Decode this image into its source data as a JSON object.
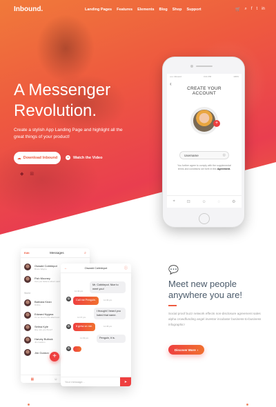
{
  "nav": {
    "logo": "Inbound.",
    "menu": [
      "Landing Pages",
      "Features",
      "Elements",
      "Blog",
      "Shop",
      "Support"
    ],
    "icons": [
      "cart-icon",
      "search-icon",
      "facebook-icon",
      "twitter-icon",
      "linkedin-icon"
    ]
  },
  "hero": {
    "title_line1": "A Messenger",
    "title_line2": "Revolution.",
    "subtitle": "Create a stylish App Landing Page and highlight all the great things of your product!",
    "download_label": "Download Inbound",
    "video_label": "Watch the Video",
    "platforms": [
      "apple-icon",
      "android-icon",
      "windows-icon"
    ]
  },
  "phone": {
    "status_left": "••••• inbound",
    "status_time": "3:21 PM",
    "status_right": "100%",
    "title": "CREATE YOUR ACCOUNT",
    "username_label": "Username",
    "terms": "You further agree to comply with the supplemental terms and conditions set forth in this",
    "terms_link": "Agreement."
  },
  "messages": {
    "edit": "Edit",
    "title": "Messages",
    "contacts": [
      {
        "name": "Oswald Cobblepot",
        "sub": "Bruce Wayne"
      },
      {
        "name": "Fish Mooney",
        "sub": "Can you believe what I said"
      },
      {
        "name": "Barbara Kean",
        "sub": "Online"
      },
      {
        "name": "Edward Nygma",
        "sub": "I'm so tired in the afternoon"
      },
      {
        "name": "Selina Kyle",
        "sub": "Hey, are you there?"
      },
      {
        "name": "Harvey Bullock",
        "sub": "Jim Gordon"
      },
      {
        "name": "Jim Gordon",
        "sub": ""
      }
    ],
    "section_label": "World"
  },
  "chat": {
    "title": "Oswald Cobblepot",
    "bubbles": [
      {
        "text": "Mr. Cobblepot. Nice to meet you!",
        "dir": "in",
        "time": "11:33 pm"
      },
      {
        "text": "Call me Penguin.",
        "dir": "out",
        "time": "11:36 pm"
      },
      {
        "text": "I thought I heard you hated that name.",
        "dir": "in",
        "time": "11:37 pm"
      },
      {
        "text": "It grew on me.",
        "dir": "out",
        "time": "11:38 pm"
      },
      {
        "text": "Penguin, it is.",
        "dir": "in",
        "time": "11:39 pm"
      }
    ],
    "input_placeholder": "Your message..."
  },
  "feature": {
    "title_line1": "Meet new people",
    "title_line2": "anywhere you are!",
    "text": "Social proof buzz network effects non-disclosure agreement sales alpha crowdfunding angel investor incubator business-to-business infographic!",
    "button_label": "Discover More"
  }
}
